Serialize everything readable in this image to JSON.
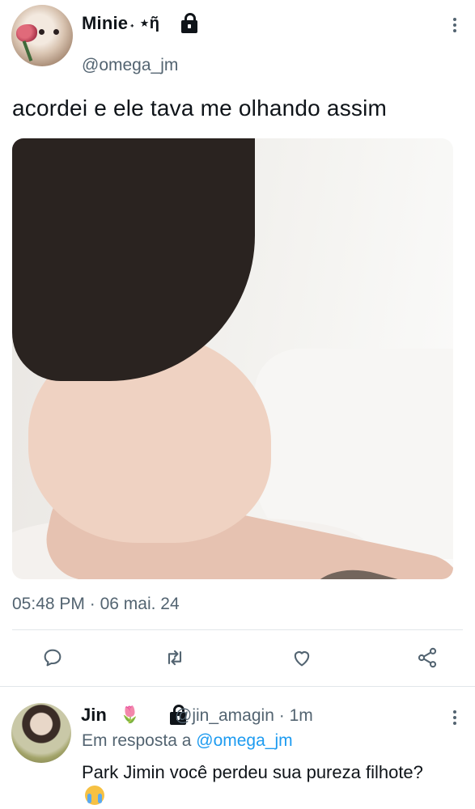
{
  "tweet": {
    "display_name": "Minie",
    "name_decoration": "˖ ⋆ῆ",
    "handle": "@omega_jm",
    "text": "acordei e ele tava me olhando assim",
    "time": "05:48 PM",
    "date": "06 mai. 24",
    "meta_separator": "·"
  },
  "reply": {
    "display_name": "Jin",
    "name_emoji": "🌷",
    "handle": "@jin_amagin",
    "separator": "·",
    "age": "1m",
    "reply_to_prefix": "Em resposta a",
    "reply_to_handle": "@omega_jm",
    "text": "Park Jimin você perdeu sua pureza filhote?",
    "text_emoji": "crying-face-emoji"
  },
  "icons": {
    "more": "more-vertical-icon",
    "lock": "lock-icon",
    "reply": "reply-icon",
    "retweet": "retweet-icon",
    "like": "heart-icon",
    "share": "share-icon"
  },
  "colors": {
    "text": "#0f1419",
    "secondary": "#536471",
    "accent": "#1d9bf0",
    "divider": "#e1e6ea"
  }
}
